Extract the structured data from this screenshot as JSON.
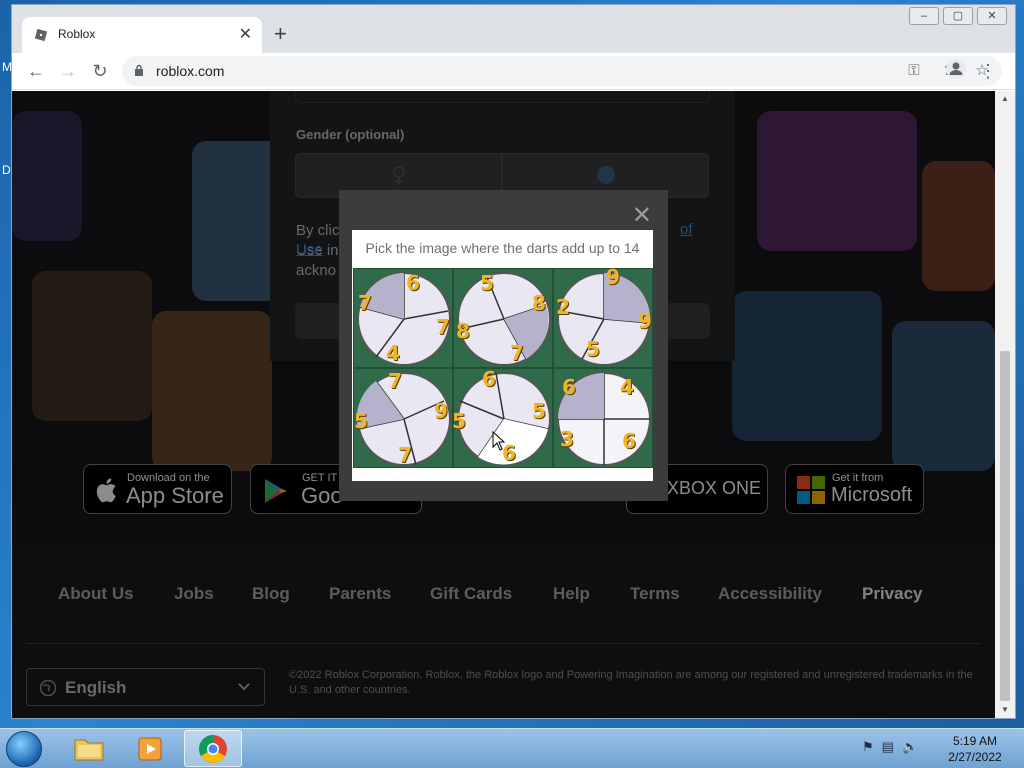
{
  "desktop": {
    "fragments": [
      "M",
      "D"
    ]
  },
  "browser": {
    "tab": {
      "title": "Roblox",
      "close": "✕"
    },
    "new_tab": "+",
    "window_buttons": [
      "–",
      "▢",
      "✕"
    ],
    "toolbar": {
      "back": "←",
      "forward": "→",
      "reload": "↻",
      "url": "roblox.com",
      "icons": [
        "key-icon",
        "share-icon",
        "star-icon",
        "profile-icon",
        "menu-icon"
      ]
    }
  },
  "page": {
    "signup": {
      "gender_label": "Gender (optional)",
      "terms_line1": "By clic",
      "terms_line2": "Use  in",
      "terms_line3": "ackno",
      "terms_link1": "of",
      "terms_link2": "Use"
    },
    "stores": [
      {
        "small": "Download on the",
        "big": "App Store",
        "icon": "apple-icon"
      },
      {
        "small": "GET IT O",
        "big": "Goo",
        "icon": "google-play-icon"
      },
      {
        "small": "",
        "big": "XBOX ONE",
        "icon": "xbox-icon"
      },
      {
        "small": "Get it from",
        "big": "Microsoft",
        "icon": "microsoft-icon"
      }
    ],
    "footer": {
      "links": [
        "About Us",
        "Jobs",
        "Blog",
        "Parents",
        "Gift Cards",
        "Help",
        "Terms",
        "Accessibility",
        "Privacy"
      ],
      "language": "English",
      "copyright": "©2022 Roblox Corporation. Roblox, the Roblox logo and Powering Imagination are among our registered and unregistered trademarks in the U.S. and other countries."
    }
  },
  "captcha": {
    "close": "✕",
    "prompt": "Pick the image where the darts add up to 14",
    "cells": [
      {
        "numbers": [
          "7",
          "6",
          "7",
          "4"
        ]
      },
      {
        "numbers": [
          "5",
          "8",
          "8",
          "7"
        ]
      },
      {
        "numbers": [
          "9",
          "2",
          "9",
          "5"
        ]
      },
      {
        "numbers": [
          "7",
          "5",
          "9",
          "7"
        ]
      },
      {
        "numbers": [
          "6",
          "5",
          "5",
          "6"
        ]
      },
      {
        "numbers": [
          "6",
          "4",
          "3",
          "6"
        ]
      }
    ]
  },
  "taskbar": {
    "tray_icons": [
      "flag-icon",
      "network-icon",
      "volume-icon"
    ],
    "time": "5:19 AM",
    "date": "2/27/2022"
  },
  "colors": {
    "accent_link": "#3a8ad6",
    "captcha_bg": "#3b3c3e",
    "felt_green": "#2f6b48",
    "number_gold": "#f0b429"
  }
}
